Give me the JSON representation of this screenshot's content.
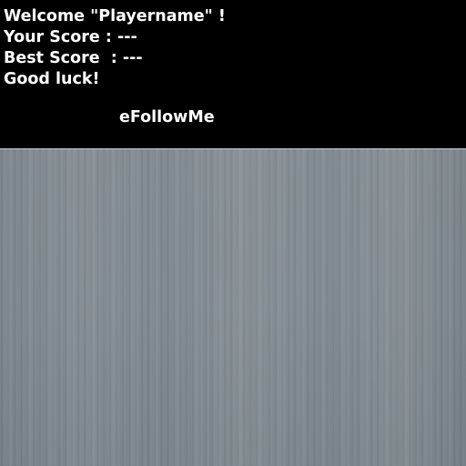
{
  "hud": {
    "welcome": "Welcome \"Playername\" !",
    "your_score": "Your Score : ---",
    "best_score": "Best Score  : ---",
    "good_luck": "Good luck!",
    "game_title": "eFollowMe"
  },
  "colors": {
    "hud_background": "#000000",
    "hud_text": "#ffffff",
    "play_area": "#b4bbc0"
  }
}
